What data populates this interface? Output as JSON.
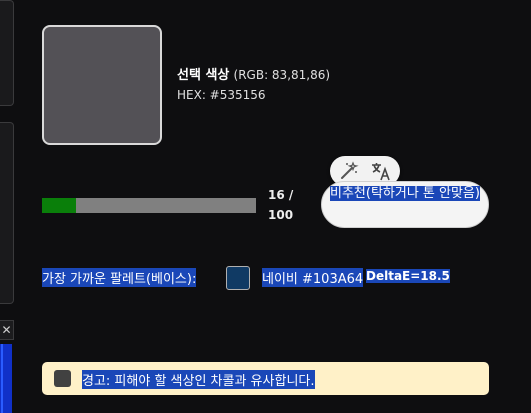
{
  "selected": {
    "title": "선택 색상",
    "rgb": "(RGB: 83,81,86)",
    "hex": "HEX: #535156",
    "color": "#535156"
  },
  "progress": {
    "count_top": "16 /",
    "count_bottom": "100",
    "fraction": 0.16,
    "fill_color": "#0a7f0a"
  },
  "toolbar": {
    "magic_icon": "magic-wand-icon",
    "translate_icon": "translate-icon"
  },
  "recommendation": {
    "text": "비추천(탁하거나 톤 안맞음)"
  },
  "palette": {
    "label": "가장 가까운 팔레트(베이스):",
    "name": "네이비 #103A64",
    "chip_color": "#103A64",
    "delta": "DeltaE=18.5"
  },
  "warning": {
    "text": "경고: 피해야 할 색상인 차콜과 유사합니다."
  },
  "edge": {
    "close_glyph": "✕"
  }
}
